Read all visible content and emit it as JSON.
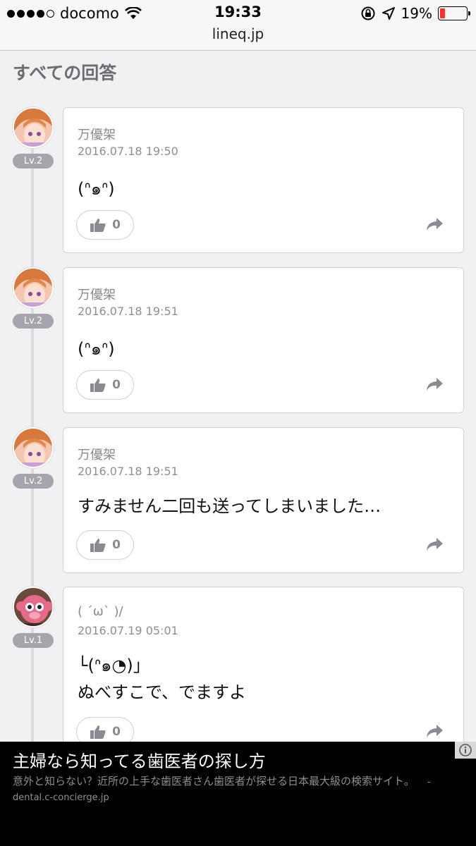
{
  "status_bar": {
    "carrier": "docomo",
    "time": "19:33",
    "battery_percent": "19%",
    "battery_level": 0.19,
    "battery_color": "#ff2d2d",
    "url": "lineq.jp"
  },
  "section_title": "すべての回答",
  "answers": [
    {
      "author": "万優架",
      "date": "2016.07.18 19:50",
      "level": "Lv.2",
      "text": "(ᐢ๑ᐢ)",
      "likes": "0",
      "avatar_icon": "anime-girl-avatar"
    },
    {
      "author": "万優架",
      "date": "2016.07.18 19:51",
      "level": "Lv.2",
      "text": "(ᐢ๑ᐢ)",
      "likes": "0",
      "avatar_icon": "anime-girl-avatar"
    },
    {
      "author": "万優架",
      "date": "2016.07.18 19:51",
      "level": "Lv.2",
      "text": "すみません二回も送ってしまいました…",
      "likes": "0",
      "avatar_icon": "anime-girl-avatar"
    },
    {
      "author": "( ´ω` )/",
      "date": "2016.07.19 05:01",
      "level": "Lv.1",
      "text": "└(ᐢ๑◔)」\nぬべすこで、でますよ",
      "likes": "0",
      "avatar_icon": "pink-monkey-avatar"
    }
  ],
  "ad": {
    "title": "主婦なら知ってる歯医者の探し方",
    "description": "意外と知らない？近所の上手な歯医者さん歯医者が探せる日本最大級の検索サイト。",
    "domain": "- dental.c-concierge.jp"
  },
  "colors": {
    "background": "#f1f1f3",
    "level_badge": "#a4a5ad",
    "ad_background": "#000000"
  }
}
